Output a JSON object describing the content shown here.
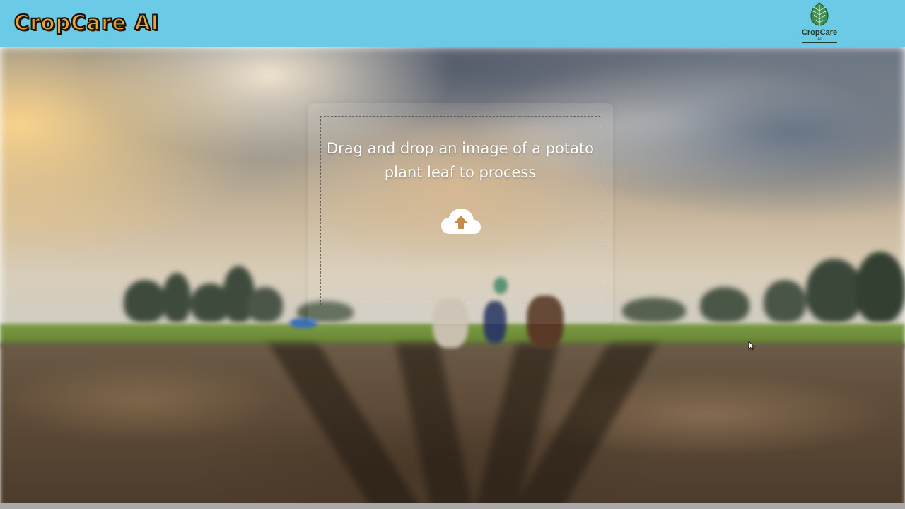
{
  "header": {
    "brand_title": "CropCare AI",
    "logo_name": "CropCare",
    "logo_sub": "AI"
  },
  "upload": {
    "instruction": "Drag and drop an image of a potato plant leaf to process",
    "icon": "cloud-upload-icon"
  },
  "colors": {
    "header_bg": "#6bcbe6",
    "brand_fill": "#e8a43a",
    "brand_outline": "#1c1208",
    "logo_green": "#2e7d4f"
  }
}
